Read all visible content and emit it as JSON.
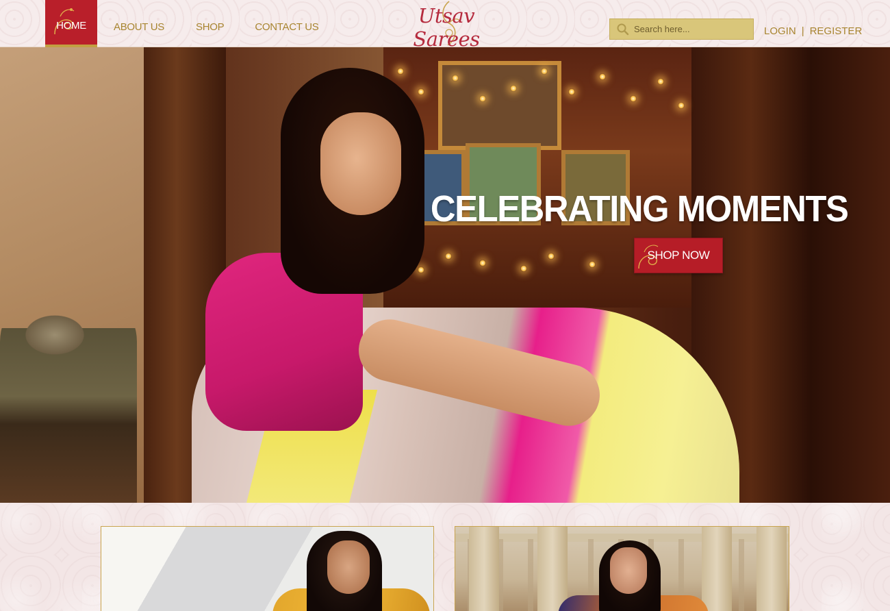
{
  "nav": {
    "home": "HOME",
    "about": "ABOUT US",
    "shop": "SHOP",
    "contact": "CONTACT US"
  },
  "logo": {
    "text": "Utsav Sarees"
  },
  "search": {
    "placeholder": "Search here..."
  },
  "auth": {
    "login": "LOGIN",
    "separator": "|",
    "register": "REGISTER"
  },
  "hero": {
    "title": "CELEBRATING MOMENTS",
    "cta": "SHOP NOW"
  },
  "colors": {
    "brand_red": "#b91f2a",
    "gold": "#a88530",
    "search_bg": "#d9c67a"
  },
  "icons": {
    "search": "search-icon",
    "swirl": "swirl-ornament-icon"
  }
}
